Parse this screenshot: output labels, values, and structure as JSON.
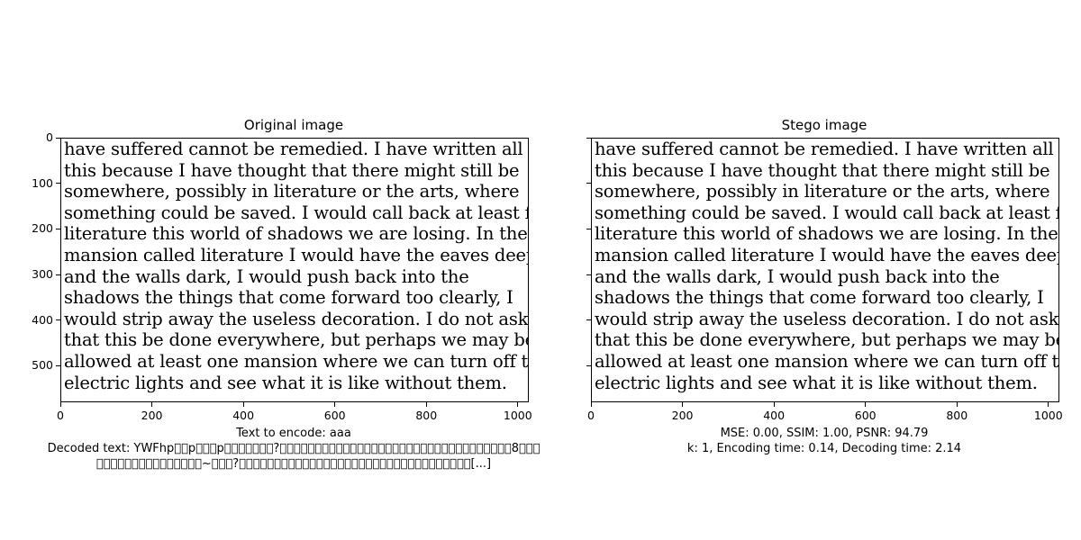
{
  "chart_data": [
    {
      "type": "image",
      "title": "Original image",
      "xlim": [
        0,
        1024
      ],
      "ylim": [
        580,
        0
      ],
      "xticks": [
        0,
        200,
        400,
        600,
        800,
        1000
      ],
      "yticks": [
        0,
        100,
        200,
        300,
        400,
        500
      ],
      "image_text": [
        "have suffered cannot be remedied. I have written all",
        "this because I have thought that there might still be",
        "somewhere, possibly in literature or the arts, where",
        "something could be saved. I would call back at least for",
        "literature this world of shadows we are losing. In the",
        "mansion called literature I would have the eaves deep",
        "and the walls dark, I would push back into the",
        "shadows the things that come forward too clearly, I",
        "would strip away the useless decoration. I do not ask",
        "that this be done everywhere, but perhaps we may be",
        "allowed at least one mansion where we can turn off the",
        "electric lights and see what it is like without them."
      ],
      "captions": [
        "Text to encode: aaa",
        "Decoded text: YWFhp\u0000\u0000p\u0000\u0000\u0000p\u0000\u0000\u0000\u0000\u0000\u0000\u0000?\u0000\u0000\u0000\u0000\u0000\u0000\u0000\u0000\u0000\u0000\u0000\u0000\u0000\u0000\u0000\u0000\u0000\u0000\u0000\u0000\u0000\u0000\u0000\u0000\u0000\u0000\u0000\u0000\u0000\u0000\u0000\u0000\u00008\u0000\u0000\u0000",
        "\u0000\u0000\u0000\u0000\u0000\u0000\u0000\u0000\u0000\u0000\u0000\u0000\u0000\u0000\u0000~\u0000\u0000\u0000?\u0000\u0000\u0000\u0000\u0000\u0000\u0000\u0000\u0000\u0000\u0000\u0000\u0000\u0000\u0000\u0000\u0000\u0000\u0000\u0000\u0000\u0000\u0000\u0000\u0000\u0000\u0000\u0000\u0000\u0000\u0000\u0000\u0000[...]"
      ]
    },
    {
      "type": "image",
      "title": "Stego image",
      "xlim": [
        0,
        1024
      ],
      "ylim": [
        580,
        0
      ],
      "xticks": [
        0,
        200,
        400,
        600,
        800,
        1000
      ],
      "yticks": [],
      "image_text": [
        "have suffered cannot be remedied. I have written all",
        "this because I have thought that there might still be",
        "somewhere, possibly in literature or the arts, where",
        "something could be saved. I would call back at least for",
        "literature this world of shadows we are losing. In the",
        "mansion called literature I would have the eaves deep",
        "and the walls dark, I would push back into the",
        "shadows the things that come forward too clearly, I",
        "would strip away the useless decoration. I do not ask",
        "that this be done everywhere, but perhaps we may be",
        "allowed at least one mansion where we can turn off the",
        "electric lights and see what it is like without them."
      ],
      "captions": [
        "MSE: 0.00, SSIM: 1.00, PSNR: 94.79",
        "k: 1, Encoding time: 0.14, Decoding time: 2.14"
      ]
    }
  ]
}
